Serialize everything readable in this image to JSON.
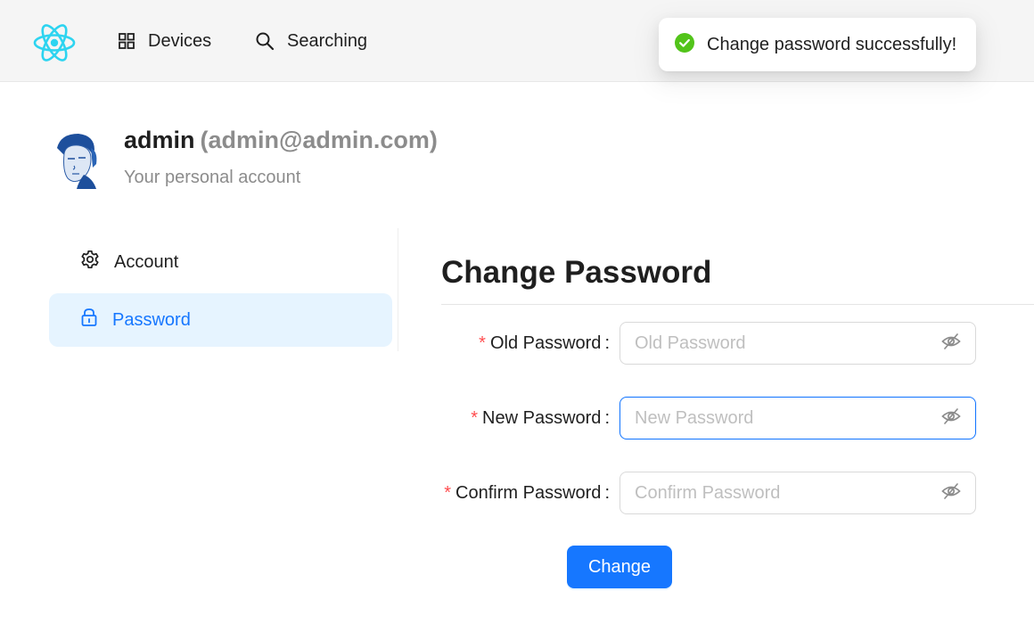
{
  "header": {
    "logo_icon": "react-atom-icon",
    "nav": [
      {
        "label": "Devices",
        "icon": "grid-icon"
      },
      {
        "label": "Searching",
        "icon": "search-icon"
      }
    ]
  },
  "toast": {
    "message": "Change password successfully!",
    "icon": "check-circle-icon",
    "status_color": "#52c41a"
  },
  "profile": {
    "name": "admin",
    "email": "(admin@admin.com)",
    "subtitle": "Your personal account"
  },
  "sidebar": {
    "items": [
      {
        "label": "Account",
        "icon": "gear-icon",
        "selected": false
      },
      {
        "label": "Password",
        "icon": "lock-icon",
        "selected": true
      }
    ]
  },
  "form": {
    "title": "Change Password",
    "fields": [
      {
        "label": "Old Password",
        "placeholder": "Old Password",
        "value": ""
      },
      {
        "label": "New Password",
        "placeholder": "New Password",
        "value": ""
      },
      {
        "label": "Confirm Password",
        "placeholder": "Confirm Password",
        "value": ""
      }
    ],
    "required_mark": "*",
    "colon": ":",
    "submit_label": "Change"
  },
  "colors": {
    "accent": "#1677ff",
    "selected_bg": "#e6f4ff",
    "required": "#ff4d4f",
    "success": "#52c41a"
  }
}
